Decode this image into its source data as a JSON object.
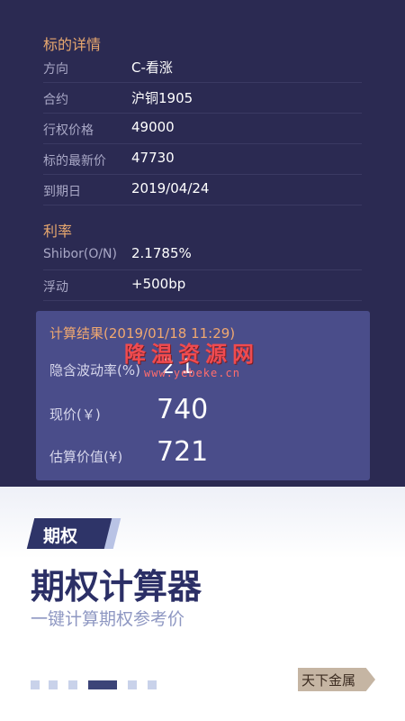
{
  "underlying": {
    "title": "标的详情",
    "rows": [
      {
        "label": "方向",
        "value": "C-看涨"
      },
      {
        "label": "合约",
        "value": "沪铜1905"
      },
      {
        "label": "行权价格",
        "value": "49000"
      },
      {
        "label": "标的最新价",
        "value": "47730"
      },
      {
        "label": "到期日",
        "value": "2019/04/24"
      }
    ]
  },
  "rate": {
    "title": "利率",
    "rows": [
      {
        "label": "Shibor(O/N)",
        "value": "2.1785%"
      },
      {
        "label": "浮动",
        "value": "+500bp"
      }
    ]
  },
  "result": {
    "title": "计算结果(2019/01/18 11:29)",
    "implied_vol_label": "隐含波动率(%)",
    "implied_vol_value": "2 1",
    "present_price_label": "现价(￥)",
    "present_price_value": "740",
    "estimated_value_label": "估算价值(¥)",
    "estimated_value_value": "721"
  },
  "watermark": {
    "text": "降温资源网",
    "url": "www.yebeke.cn"
  },
  "promo": {
    "tag": "期权",
    "title": "期权计算器",
    "subtitle": "一键计算期权参考价",
    "brand": "天下金属"
  },
  "pagination": {
    "total": 6,
    "active_index": 3
  },
  "colors": {
    "top_bg": "#2b2a52",
    "accent": "#e8a86f",
    "card_bg": "#4a4d8a",
    "title": "#2b2f66"
  }
}
